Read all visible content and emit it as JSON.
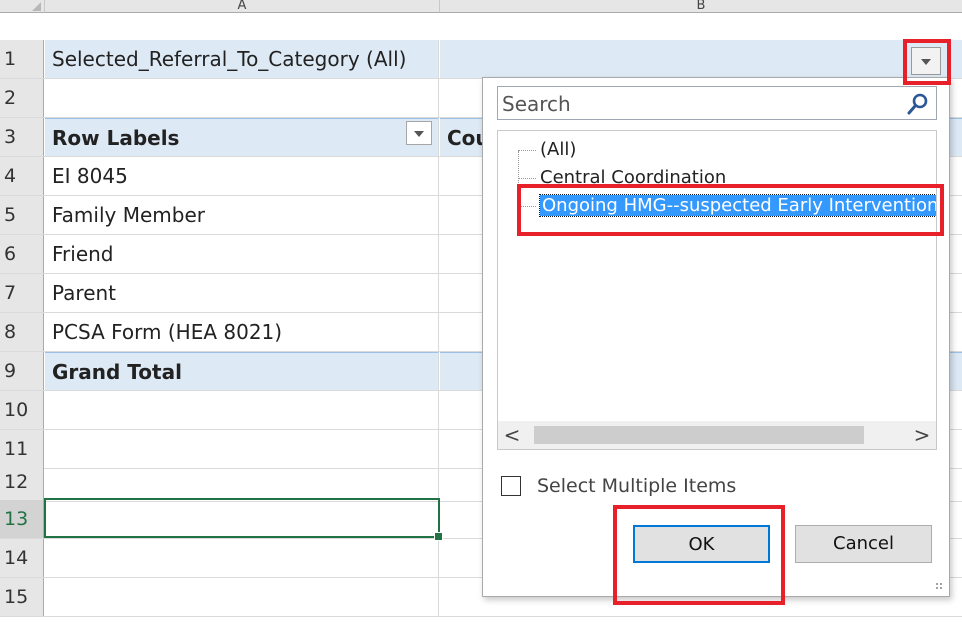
{
  "columns": [
    "A",
    "B"
  ],
  "rows": [
    {
      "num": "1",
      "a": "Selected_Referral_To_Category   (All)",
      "b": ""
    },
    {
      "num": "2",
      "a": "",
      "b": ""
    },
    {
      "num": "3",
      "a": "Row Labels",
      "b": "Cou"
    },
    {
      "num": "4",
      "a": "EI 8045",
      "b": ""
    },
    {
      "num": "5",
      "a": "Family Member",
      "b": ""
    },
    {
      "num": "6",
      "a": "Friend",
      "b": ""
    },
    {
      "num": "7",
      "a": "Parent",
      "b": ""
    },
    {
      "num": "8",
      "a": "PCSA Form (HEA 8021)",
      "b": ""
    },
    {
      "num": "9",
      "a": "Grand Total",
      "b": ""
    },
    {
      "num": "10",
      "a": "",
      "b": ""
    },
    {
      "num": "11",
      "a": "",
      "b": ""
    },
    {
      "num": "12",
      "a": "",
      "b": ""
    },
    {
      "num": "13",
      "a": "",
      "b": ""
    },
    {
      "num": "14",
      "a": "",
      "b": ""
    },
    {
      "num": "15",
      "a": "",
      "b": ""
    }
  ],
  "filter_panel": {
    "search_placeholder": "Search",
    "items": [
      {
        "label": "(All)",
        "selected": false
      },
      {
        "label": "Central Coordination",
        "selected": false
      },
      {
        "label": "Ongoing HMG--suspected Early Intervention",
        "selected": true
      }
    ],
    "scroll_left": "<",
    "scroll_right": ">",
    "select_multiple_label": "Select Multiple Items",
    "select_multiple_checked": false,
    "ok_label": "OK",
    "cancel_label": "Cancel"
  },
  "colors": {
    "highlight_box": "#e8202a",
    "selection": "#3399ff",
    "pivot_tint": "#dde9f5",
    "active_cell": "#217346"
  },
  "icons": [
    "filter-dropdown-arrow-icon",
    "search-icon",
    "scroll-left-icon",
    "scroll-right-icon",
    "resize-grip-icon"
  ]
}
